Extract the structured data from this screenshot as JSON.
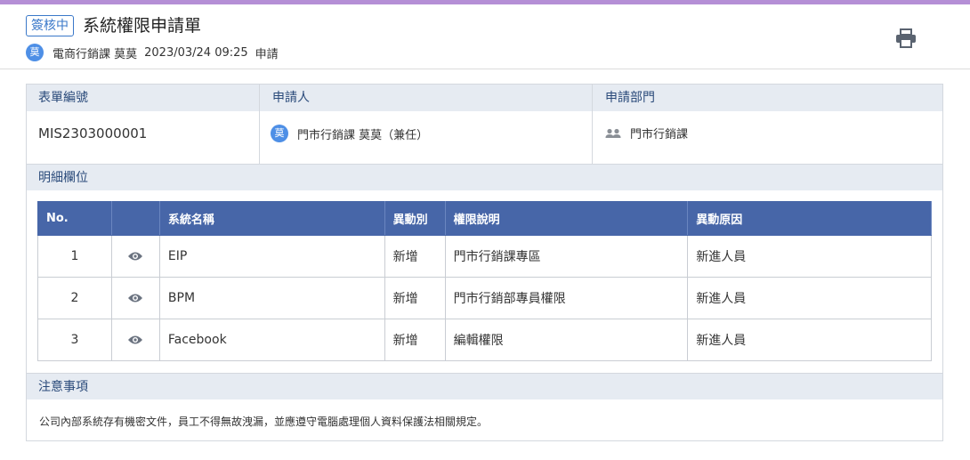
{
  "header": {
    "status": "簽核中",
    "title": "系統權限申請單",
    "avatar_char": "莫",
    "requester": "電商行銷課 莫莫",
    "datetime": "2023/03/24 09:25",
    "action": "申請"
  },
  "info": {
    "form_number_label": "表單編號",
    "applicant_label": "申請人",
    "department_label": "申請部門",
    "form_number": "MIS2303000001",
    "applicant_avatar": "莫",
    "applicant": "門市行銷課 莫莫（兼任）",
    "department": "門市行銷課"
  },
  "details": {
    "section_title": "明細欄位",
    "columns": [
      "No.",
      "",
      "系統名稱",
      "異動別",
      "權限說明",
      "異動原因"
    ],
    "rows": [
      {
        "no": "1",
        "system": "EIP",
        "change_type": "新增",
        "permission": "門市行銷課專區",
        "reason": "新進人員"
      },
      {
        "no": "2",
        "system": "BPM",
        "change_type": "新增",
        "permission": "門市行銷部專員權限",
        "reason": "新進人員"
      },
      {
        "no": "3",
        "system": "Facebook",
        "change_type": "新增",
        "permission": "編輯權限",
        "reason": "新進人員"
      }
    ]
  },
  "notice": {
    "section_title": "注意事項",
    "text": "公司內部系統存有機密文件，員工不得無故洩漏，並應遵守電腦處理個人資料保護法相關規定。"
  },
  "icons": {
    "print": "print-icon",
    "view": "eye-icon",
    "department": "people-icon"
  },
  "colors": {
    "accent": "#3a78c9",
    "table_header": "#4766a8",
    "section_bg": "#e6ebf2",
    "top_stripe": "#b58fd6"
  }
}
